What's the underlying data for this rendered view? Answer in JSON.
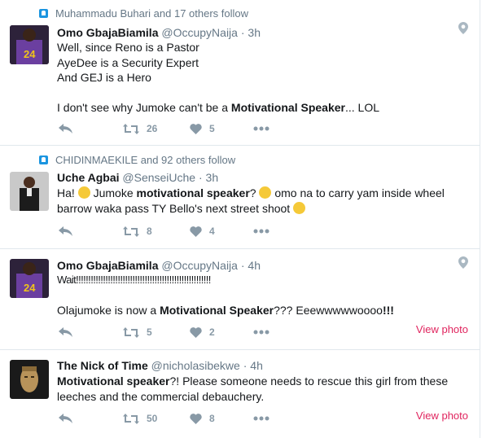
{
  "tweets": [
    {
      "social": "Muhammadu Buhari and 17 others follow",
      "name": "Omo GbajaBiamila",
      "handle": "@OccupyNaija",
      "time": "3h",
      "lines": [
        "Well, since Reno is a Pastor",
        "AyeDee is a Security Expert",
        "And GEJ is a Hero",
        "",
        "I don't see why Jumoke can't be a",
        "Motivational Speaker",
        "... LOL"
      ],
      "retweets": "26",
      "likes": "5"
    },
    {
      "social": "CHIDINMAEKILE and 92 others follow",
      "name": "Uche Agbai",
      "handle": "@SenseiUche",
      "time": "3h",
      "line1a": "Ha!",
      "line1b": "Jumoke",
      "line1bold": "motivational speaker",
      "line1c": "?",
      "line1d": "omo na to carry yam inside wheel",
      "line2": "barrow waka pass TY Bello's next street shoot",
      "retweets": "8",
      "likes": "4"
    },
    {
      "name": "Omo GbajaBiamila",
      "handle": "@OccupyNaija",
      "time": "4h",
      "line1": "Wait!!!!!!!!!!!!!!!!!!!!!!!!!!!!!!!!!!!!!!!!!!!!!!!!!!!!!!!",
      "line2a": "Olajumoke is now a",
      "line2bold": "Motivational Speaker",
      "line2b": "??? Eeewwwwwoooo",
      "line2c": "!!!",
      "retweets": "5",
      "likes": "2",
      "view_photo": "View photo"
    },
    {
      "name": "The Nick of Time",
      "handle": "@nicholasibekwe",
      "time": "4h",
      "line1bold": "Motivational speaker",
      "line1a": "?! Please someone needs to rescue this girl from these",
      "line2": "leeches and the commercial debauchery.",
      "retweets": "50",
      "likes": "8",
      "view_photo": "View photo"
    }
  ],
  "icons": {
    "reply": "reply-icon",
    "retweet": "retweet-icon",
    "like": "heart-icon",
    "more": "more-icon",
    "location": "location-pin-icon",
    "follow": "follow-social-icon"
  },
  "colors": {
    "text": "#14171a",
    "muted": "#657786",
    "action": "#8899a6",
    "view_photo": "#e0245e",
    "social_icon": "#1b95e0"
  }
}
